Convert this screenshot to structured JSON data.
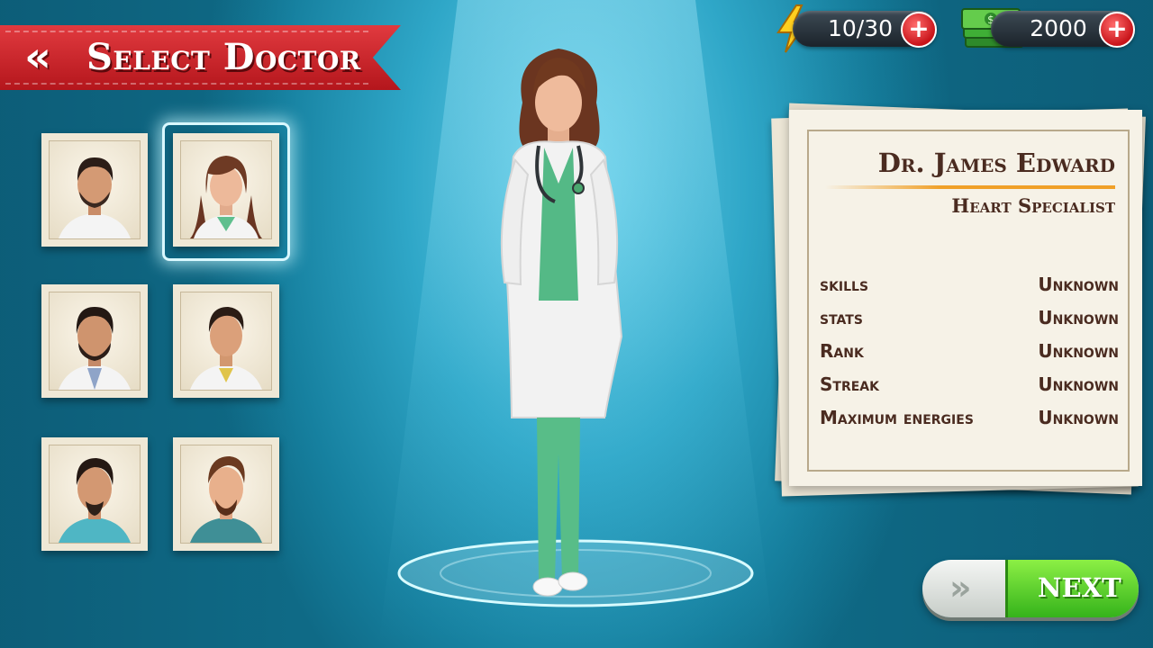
{
  "header": {
    "back_icon": "double-chevron-left-icon",
    "title": "Select Doctor"
  },
  "resources": {
    "energy": {
      "icon": "lightning-bolt-icon",
      "value": "10/30",
      "plus": "+"
    },
    "cash": {
      "icon": "cash-stack-icon",
      "value": "2000",
      "plus": "+"
    }
  },
  "doctors": [
    {
      "portrait": "male-doctor-portrait-1",
      "selected": false
    },
    {
      "portrait": "female-doctor-portrait",
      "selected": true
    },
    {
      "portrait": "male-doctor-portrait-2",
      "selected": false
    },
    {
      "portrait": "male-doctor-portrait-3",
      "selected": false
    },
    {
      "portrait": "male-doctor-portrait-4",
      "selected": false
    },
    {
      "portrait": "male-doctor-portrait-5",
      "selected": false
    }
  ],
  "profile": {
    "name": "Dr. James Edward",
    "specialty": "Heart Specialist",
    "stats": [
      {
        "label": "skills",
        "value": "Unknown"
      },
      {
        "label": "stats",
        "value": "Unknown"
      },
      {
        "label": "Rank",
        "value": "Unknown"
      },
      {
        "label": "Streak",
        "value": "Unknown"
      },
      {
        "label": "Maximum energies",
        "value": "Unknown"
      }
    ]
  },
  "next": {
    "icon": "double-chevron-right-icon",
    "label": "NEXT"
  },
  "colors": {
    "ribbon": "#c8202a",
    "next_green": "#5cd22c",
    "background": "#2fa7c8",
    "text_brown": "#4a2b20"
  }
}
